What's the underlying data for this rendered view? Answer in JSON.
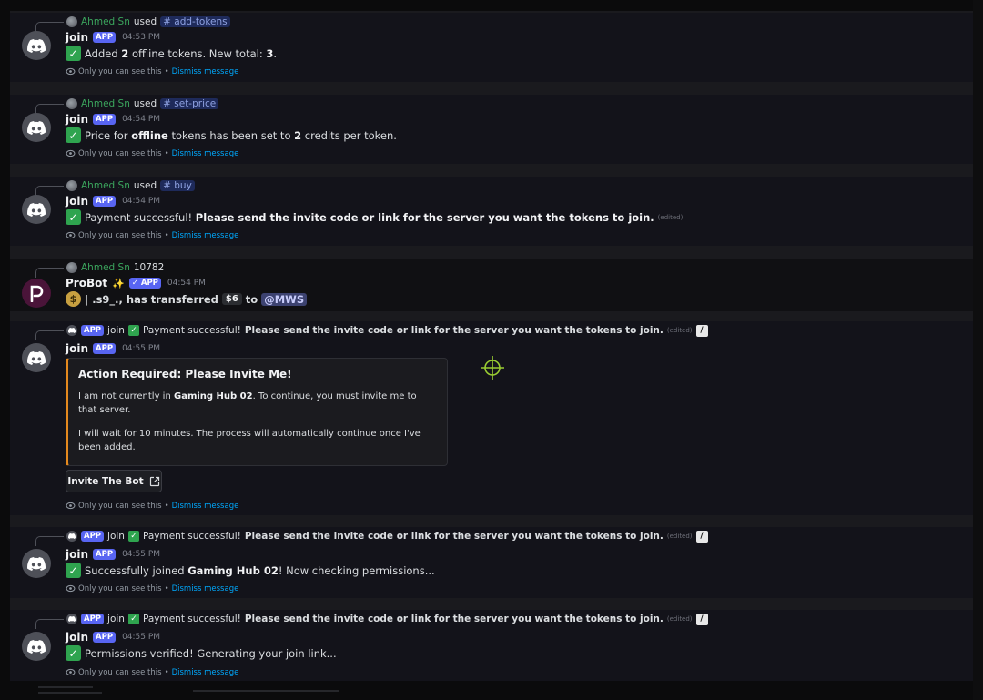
{
  "messages": [
    {
      "ref": {
        "user": "Ahmed Sn",
        "verb": "used",
        "command": "# add-tokens"
      },
      "author": "join",
      "badge": "APP",
      "time": "04:53 PM",
      "text_pre": "Added ",
      "text_b1": "2",
      "text_mid": " offline tokens. New total: ",
      "text_b2": "3",
      "text_post": ".",
      "ephemeral": {
        "note": "Only you can see this",
        "sep": "•",
        "dismiss": "Dismiss message"
      }
    },
    {
      "ref": {
        "user": "Ahmed Sn",
        "verb": "used",
        "command": "# set-price"
      },
      "author": "join",
      "badge": "APP",
      "time": "04:54 PM",
      "text_pre": "Price for ",
      "text_b1": "offline",
      "text_mid": " tokens has been set to ",
      "text_b2": "2",
      "text_post": " credits per token.",
      "ephemeral": {
        "note": "Only you can see this",
        "sep": "•",
        "dismiss": "Dismiss message"
      }
    },
    {
      "ref": {
        "user": "Ahmed Sn",
        "verb": "used",
        "command": "# buy"
      },
      "author": "join",
      "badge": "APP",
      "time": "04:54 PM",
      "text_pre": "Payment successful! ",
      "text_b1": "Please send the invite code or link for the server you want the tokens to join.",
      "edited": "(edited)",
      "ephemeral": {
        "note": "Only you can see this",
        "sep": "•",
        "dismiss": "Dismiss message"
      }
    },
    {
      "ref": {
        "user": "Ahmed Sn",
        "extra": "10782"
      },
      "author": "ProBot",
      "sparkle": "✨",
      "badge": "✓ APP",
      "time": "04:54 PM",
      "text_pre": "| .s9_., has transferred ",
      "amount": "$6",
      "text_mid": " to ",
      "mention": "@MWS"
    },
    {
      "ref": {
        "badge": "APP",
        "user": "join",
        "text_pre": "Payment successful! ",
        "text_b": "Please send the invite code or link for the server you want the tokens to join.",
        "edited": "(edited)"
      },
      "author": "join",
      "badge": "APP",
      "time": "04:55 PM",
      "embed": {
        "title": "Action Required: Please Invite Me!",
        "p1_pre": "I am not currently in ",
        "p1_b": "Gaming Hub 02",
        "p1_post": ". To continue, you must invite me to that server.",
        "p2": "I will wait for 10 minutes. The process will automatically continue once I've been added."
      },
      "button": "Invite The Bot",
      "ephemeral": {
        "note": "Only you can see this",
        "sep": "•",
        "dismiss": "Dismiss message"
      }
    },
    {
      "ref": {
        "badge": "APP",
        "user": "join",
        "text_pre": "Payment successful! ",
        "text_b": "Please send the invite code or link for the server you want the tokens to join.",
        "edited": "(edited)"
      },
      "author": "join",
      "badge": "APP",
      "time": "04:55 PM",
      "text_pre": "Successfully joined ",
      "text_b1": "Gaming Hub 02",
      "text_post": "! Now checking permissions...",
      "ephemeral": {
        "note": "Only you can see this",
        "sep": "•",
        "dismiss": "Dismiss message"
      }
    },
    {
      "ref": {
        "badge": "APP",
        "user": "join",
        "text_pre": "Payment successful! ",
        "text_b": "Please send the invite code or link for the server you want the tokens to join.",
        "edited": "(edited)"
      },
      "author": "join",
      "badge": "APP",
      "time": "04:55 PM",
      "text_pre": "Permissions verified! Generating your join link...",
      "ephemeral": {
        "note": "Only you can see this",
        "sep": "•",
        "dismiss": "Dismiss message"
      }
    }
  ],
  "colors": {
    "accent": "#5865f2",
    "embed_border": "#e4891e",
    "link": "#00a8fc",
    "user_green": "#3ba55d"
  },
  "icons": [
    "discord-logo-icon",
    "eye-icon",
    "external-link-icon",
    "check-emoji-icon",
    "money-bag-emoji-icon",
    "crosshair-icon"
  ]
}
